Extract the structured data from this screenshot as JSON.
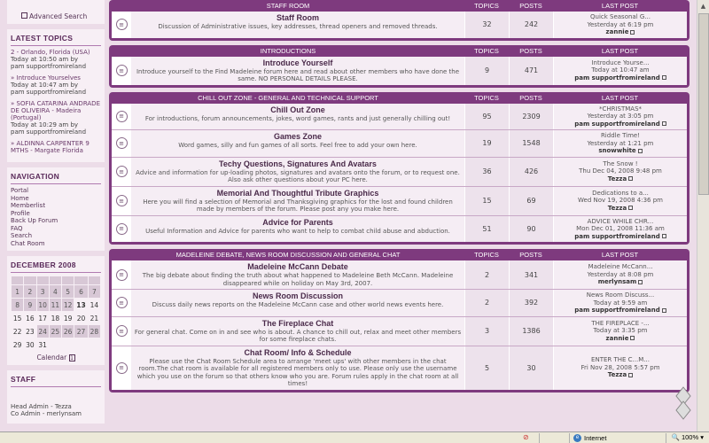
{
  "sidebar": {
    "advanced_search": "Advanced Search",
    "latest_title": "LATEST TOPICS",
    "latest": [
      {
        "title": "2 - Orlando, Florida (USA)",
        "time": "Today at 10:50 am by",
        "user": "pam supportfromireland"
      },
      {
        "title": "» Introduce Yourselves",
        "time": "Today at 10:47 am by",
        "user": "pam supportfromireland"
      },
      {
        "title": "» SOFIA CATARINA ANDRADE DE OLIVEIRA - Madeira (Portugal)",
        "time": "Today at 10:29 am by",
        "user": "pam supportfromireland"
      },
      {
        "title": "» ALDINNA CARPENTER 9 MTHS - Margate Florida",
        "time": "",
        "user": ""
      }
    ],
    "nav_title": "NAVIGATION",
    "nav": [
      "Portal",
      "Home",
      "Memberlist",
      "Profile",
      "Back Up Forum",
      "FAQ",
      "Search",
      "Chat Room"
    ],
    "calendar_title": "DECEMBER 2008",
    "calendar_rows": [
      [
        "1",
        "2",
        "3",
        "4",
        "5",
        "6",
        "7"
      ],
      [
        "8",
        "9",
        "10",
        "11",
        "12",
        "13",
        "14"
      ],
      [
        "15",
        "16",
        "17",
        "18",
        "19",
        "20",
        "21"
      ],
      [
        "22",
        "23",
        "24",
        "25",
        "26",
        "27",
        "28"
      ],
      [
        "29",
        "30",
        "31",
        "",
        "",
        "",
        ""
      ]
    ],
    "calendar_link": "Calendar",
    "staff_title": "STAFF",
    "staff": [
      "Head Admin - Tezza",
      "Co Admin - merlynsam"
    ]
  },
  "categories": [
    {
      "name": "STAFF ROOM",
      "topics_label": "TOPICS",
      "posts_label": "POSTS",
      "last_label": "LAST POST",
      "forums": [
        {
          "title": "Staff Room",
          "desc": "Discussion of Administrative issues, key addresses, thread openers and removed threads.",
          "topics": "32",
          "posts": "242",
          "last_title": "Quick Seasonal G...",
          "last_time": "Yesterday at 6:19 pm",
          "last_user": "zannie"
        }
      ]
    },
    {
      "name": "INTRODUCTIONS",
      "topics_label": "TOPICS",
      "posts_label": "POSTS",
      "last_label": "LAST POST",
      "forums": [
        {
          "title": "Introduce Yourself",
          "desc": "Introduce yourself to the Find Madeleine forum here and read about other members who have done the same. NO PERSONAL DETAILS PLEASE.",
          "topics": "9",
          "posts": "471",
          "last_title": "Introduce Yourse...",
          "last_time": "Today at 10:47 am",
          "last_user": "pam supportfromireland"
        }
      ]
    },
    {
      "name": "CHILL OUT ZONE - GENERAL AND TECHNICAL SUPPORT",
      "topics_label": "TOPICS",
      "posts_label": "POSTS",
      "last_label": "LAST POST",
      "forums": [
        {
          "title": "Chill Out Zone",
          "desc": "For introductions, forum announcements, jokes, word games, rants and just generally chilling out!",
          "topics": "95",
          "posts": "2309",
          "last_title": "*CHRISTMAS*",
          "last_time": "Yesterday at 3:05 pm",
          "last_user": "pam supportfromireland"
        },
        {
          "title": "Games Zone",
          "desc": "Word games, silly and fun games of all sorts. Feel free to add your own here.",
          "topics": "19",
          "posts": "1548",
          "last_title": "Riddle Time!",
          "last_time": "Yesterday at 1:21 pm",
          "last_user": "snowwhite"
        },
        {
          "title": "Techy Questions, Signatures And Avatars",
          "desc": "Advice and information for up-loading photos, signatures and avatars onto the forum, or to request one. Also ask other questions about your PC here.",
          "topics": "36",
          "posts": "426",
          "last_title": "The Snow !",
          "last_time": "Thu Dec 04, 2008 9:48 pm",
          "last_user": "Tezza"
        },
        {
          "title": "Memorial And Thoughtful Tribute Graphics",
          "desc": "Here you will find a selection of Memorial and Thanksgiving graphics for the lost and found children made by members of the forum. Please post any you make here.",
          "topics": "15",
          "posts": "69",
          "last_title": "Dedications to a...",
          "last_time": "Wed Nov 19, 2008 4:36 pm",
          "last_user": "Tezza"
        },
        {
          "title": "Advice for Parents",
          "desc": "Useful Information and Advice for parents who want to help to combat child abuse and abduction.",
          "topics": "51",
          "posts": "90",
          "last_title": "ADVICE WHILE CHR...",
          "last_time": "Mon Dec 01, 2008 11:36 am",
          "last_user": "pam supportfromireland"
        }
      ]
    },
    {
      "name": "MADELEINE DEBATE, NEWS ROOM DISCUSSION AND GENERAL CHAT",
      "topics_label": "TOPICS",
      "posts_label": "POSTS",
      "last_label": "LAST POST",
      "forums": [
        {
          "title": "Madeleine McCann Debate",
          "desc": "The big debate about finding the truth about what happened to Madeleine Beth McCann. Madeleine disappeared while on holiday on May 3rd, 2007.",
          "topics": "2",
          "posts": "341",
          "last_title": "Madeleine McCann...",
          "last_time": "Yesterday at 8:08 pm",
          "last_user": "merlynsam"
        },
        {
          "title": "News Room Discussion",
          "desc": "Discuss daily news reports on the Madeleine McCann case and other world news events here.",
          "topics": "2",
          "posts": "392",
          "last_title": "News Room Discuss...",
          "last_time": "Today at 9:59 am",
          "last_user": "pam supportfromireland"
        },
        {
          "title": "The Fireplace Chat",
          "desc": "For general chat. Come on in and see who is about. A chance to chill out, relax and meet other members for some fireplace chats.",
          "topics": "3",
          "posts": "1386",
          "last_title": "THE FIREPLACE -...",
          "last_time": "Today at 3:35 pm",
          "last_user": "zannie"
        },
        {
          "title": "Chat Room/ Info & Schedule",
          "desc": "Please use the Chat Room Schedule area to arrange 'meet ups' with other members in the chat room.The chat room is available for all registered members only to use. Please only use the username which you use on the forum so that others know who you are. Forum rules apply in the chat room at all times!",
          "topics": "5",
          "posts": "30",
          "last_title": "ENTER THE C...M...",
          "last_time": "Fri Nov 28, 2008 5:57 pm",
          "last_user": "Tezza"
        }
      ]
    }
  ],
  "statusbar": {
    "zone": "Internet",
    "zoom": "100%"
  }
}
